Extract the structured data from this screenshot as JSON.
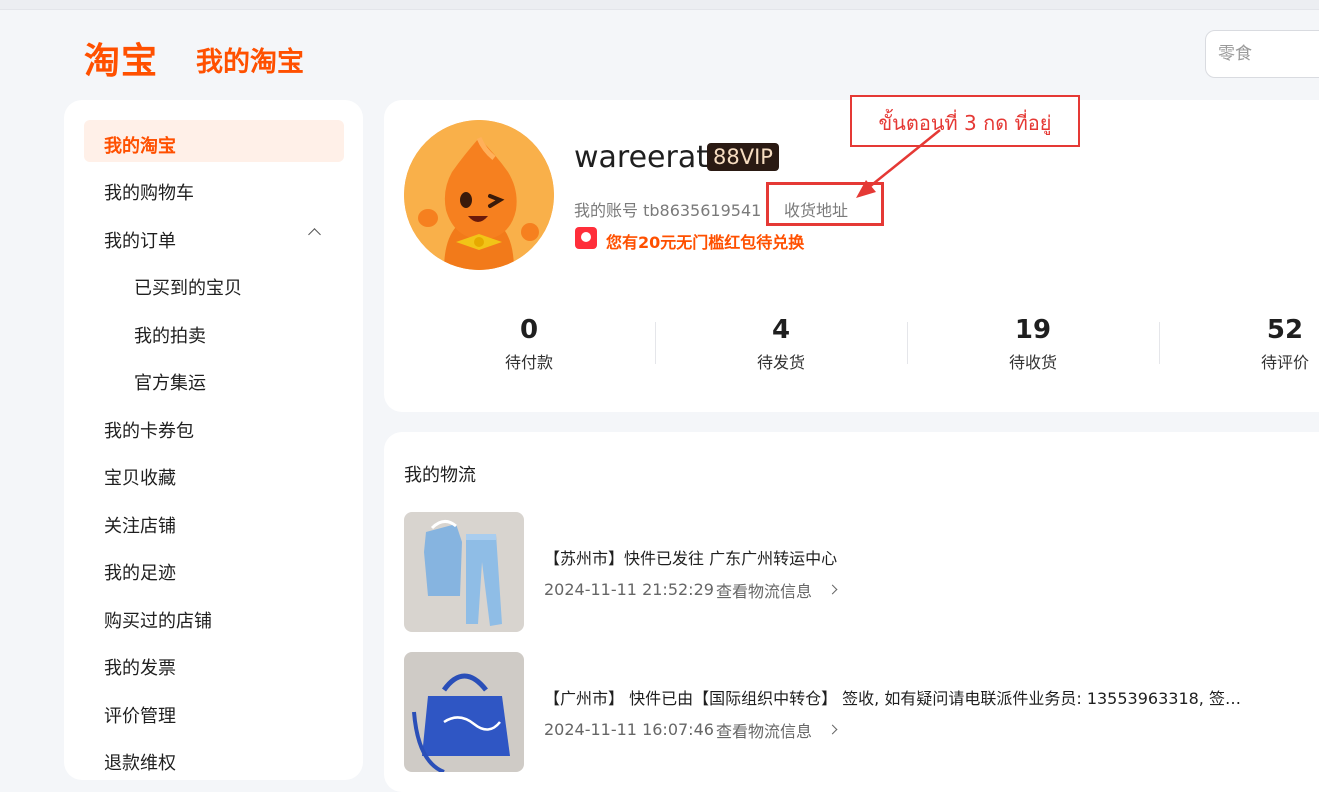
{
  "header": {
    "logo": "淘宝",
    "title": "我的淘宝",
    "search_placeholder": "零食"
  },
  "sidebar": {
    "items": [
      {
        "label": "我的淘宝"
      },
      {
        "label": "我的购物车"
      },
      {
        "label": "我的订单"
      },
      {
        "label": "已买到的宝贝"
      },
      {
        "label": "我的拍卖"
      },
      {
        "label": "官方集运"
      },
      {
        "label": "我的卡券包"
      },
      {
        "label": "宝贝收藏"
      },
      {
        "label": "关注店铺"
      },
      {
        "label": "我的足迹"
      },
      {
        "label": "购买过的店铺"
      },
      {
        "label": "我的发票"
      },
      {
        "label": "评价管理"
      },
      {
        "label": "退款维权"
      }
    ]
  },
  "profile": {
    "username": "wareerat",
    "vip": "88VIP",
    "account": "我的账号 tb8635619541",
    "address_link": "收货地址",
    "coupon_text": "您有20元无门槛红包待兑换"
  },
  "stats": [
    {
      "value": "0",
      "label": "待付款"
    },
    {
      "value": "4",
      "label": "待发货"
    },
    {
      "value": "19",
      "label": "待收货"
    },
    {
      "value": "52",
      "label": "待评价"
    }
  ],
  "logistics": {
    "title": "我的物流",
    "items": [
      {
        "message": "【苏州市】快件已发往 广东广州转运中心",
        "time": "2024-11-11 21:52:29",
        "link": "查看物流信息"
      },
      {
        "message": "【广州市】 快件已由【国际组织中转仓】 签收, 如有疑问请电联派件业务员: 13553963318, 签…",
        "time": "2024-11-11 16:07:46",
        "link": "查看物流信息"
      }
    ]
  },
  "annotation": {
    "callout": "ขั้นตอนที่ 3 กด ที่อยู่",
    "color": "#e53935"
  },
  "colors": {
    "brand": "#ff5000",
    "background": "#f4f6f9"
  }
}
